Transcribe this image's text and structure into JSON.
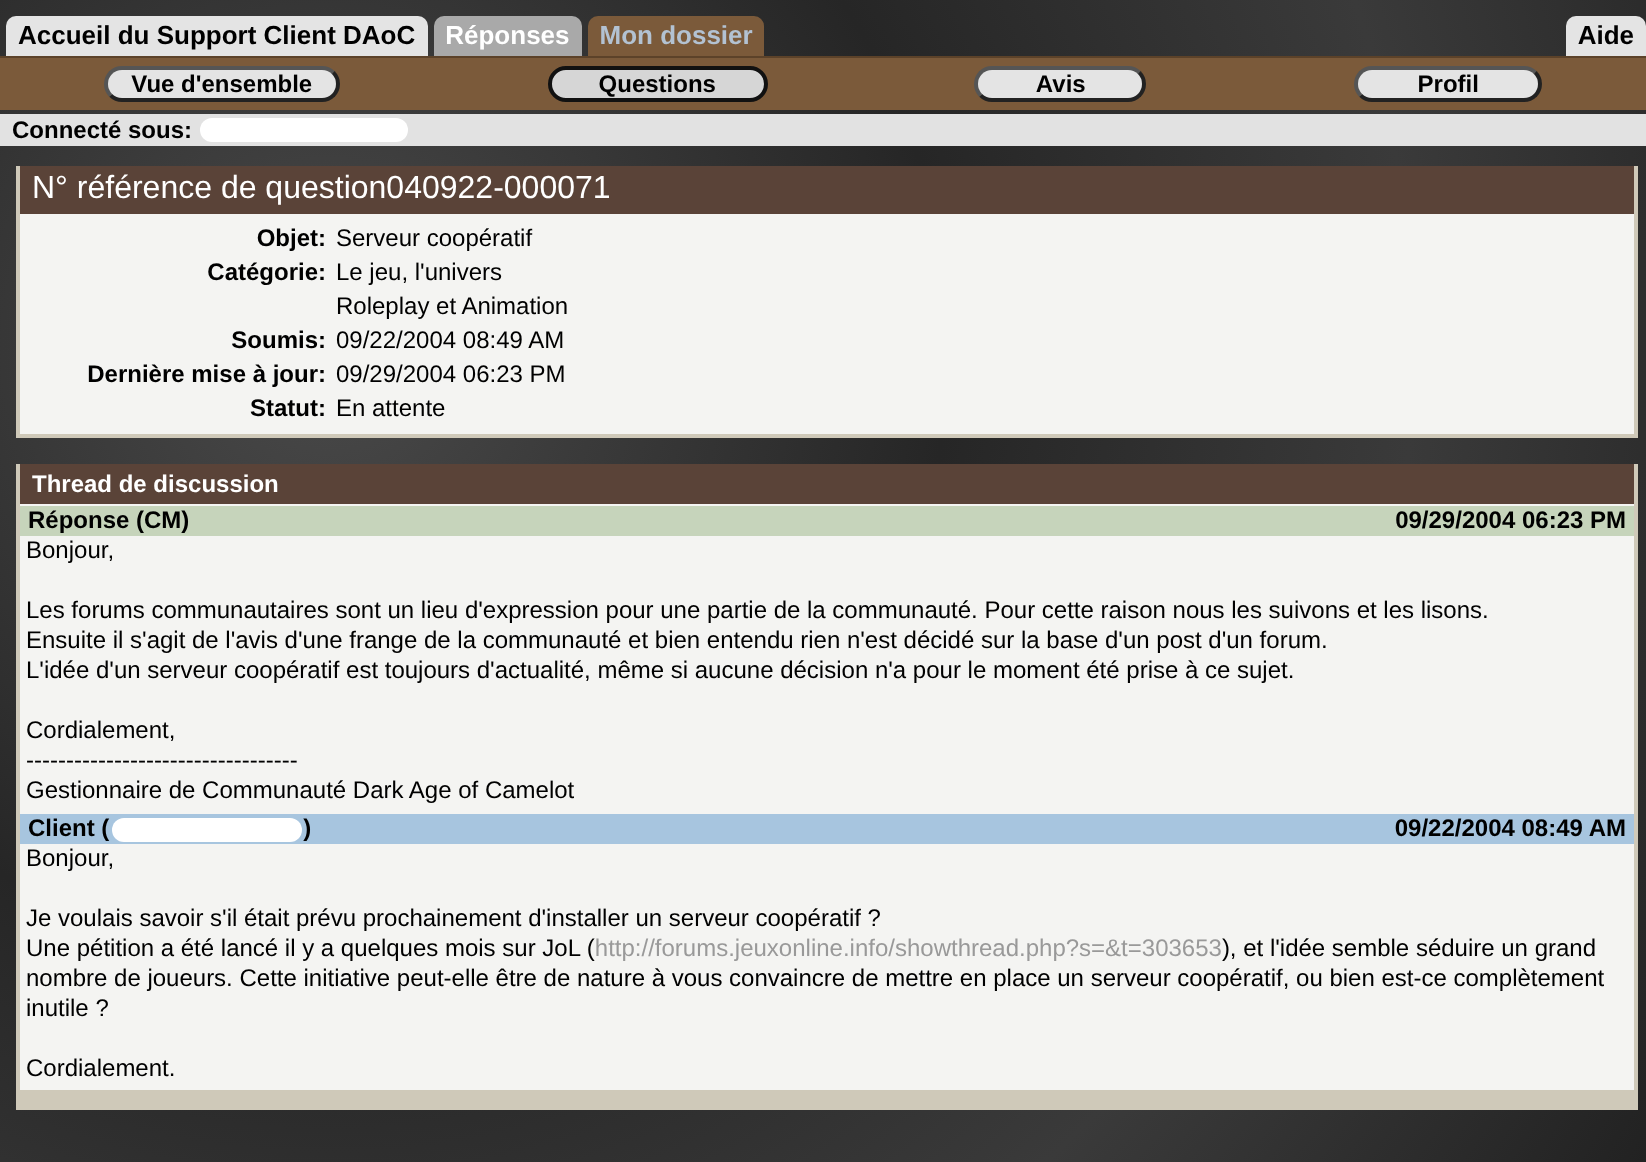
{
  "tabs": [
    {
      "label": "Accueil du Support Client DAoC",
      "kind": "home",
      "selected": false
    },
    {
      "label": "Réponses",
      "kind": "section",
      "selected": false
    },
    {
      "label": "Mon dossier",
      "kind": "section",
      "selected": true
    }
  ],
  "help_tab": "Aide",
  "subnav": [
    {
      "label": "Vue d'ensemble",
      "selected": false
    },
    {
      "label": "Questions",
      "selected": true
    },
    {
      "label": "Avis",
      "selected": false
    },
    {
      "label": "Profil",
      "selected": false
    }
  ],
  "login": {
    "label": "Connecté sous:",
    "redacted": true
  },
  "question": {
    "title": "N° référence de question040922-000071",
    "fields": [
      {
        "label": "Objet:",
        "values": [
          "Serveur coopératif"
        ]
      },
      {
        "label": "Catégorie:",
        "values": [
          "Le jeu, l'univers",
          "Roleplay et Animation"
        ]
      },
      {
        "label": "Soumis:",
        "values": [
          "09/22/2004 08:49 AM"
        ]
      },
      {
        "label": "Dernière mise à jour:",
        "values": [
          "09/29/2004 06:23 PM"
        ]
      },
      {
        "label": "Statut:",
        "values": [
          "En attente"
        ]
      }
    ]
  },
  "thread": {
    "title": "Thread de discussion",
    "messages": [
      {
        "kind": "staff",
        "author": "Réponse (CM)",
        "date": "09/29/2004 06:23 PM",
        "paragraphs": [
          {
            "text": "Bonjour,"
          },
          {
            "text": "Les forums communautaires sont un lieu d'expression pour une partie de la communauté. Pour cette raison nous les suivons et les lisons.\nEnsuite il s'agit de l'avis d'une frange de la communauté et bien entendu rien n'est décidé sur la base d'un post d'un forum.\nL'idée d'un serveur coopératif est toujours d'actualité, même si aucune décision n'a pour le moment été prise à ce sujet."
          },
          {
            "text": "Cordialement,\n----------------------------------\nGestionnaire de Communauté Dark Age of Camelot"
          }
        ]
      },
      {
        "kind": "client",
        "author": "Client (",
        "author_end": ")",
        "redacted": true,
        "date": "09/22/2004 08:49 AM",
        "paragraphs": [
          {
            "text": "Bonjour,"
          },
          {
            "text": "Je voulais savoir s'il était prévu prochainement d'installer un serveur coopératif ?\nUne pétition a été lancé il y a quelques mois sur JoL (",
            "link": "http://forums.jeuxonline.info/showthread.php?s=&t=303653",
            "after": "), et l'idée semble séduire un grand nombre de joueurs. Cette initiative peut-elle être de nature à vous convaincre de mettre en place un serveur coopératif, ou bien est-ce complètement inutile ?"
          },
          {
            "text": "Cordialement."
          }
        ]
      }
    ]
  }
}
